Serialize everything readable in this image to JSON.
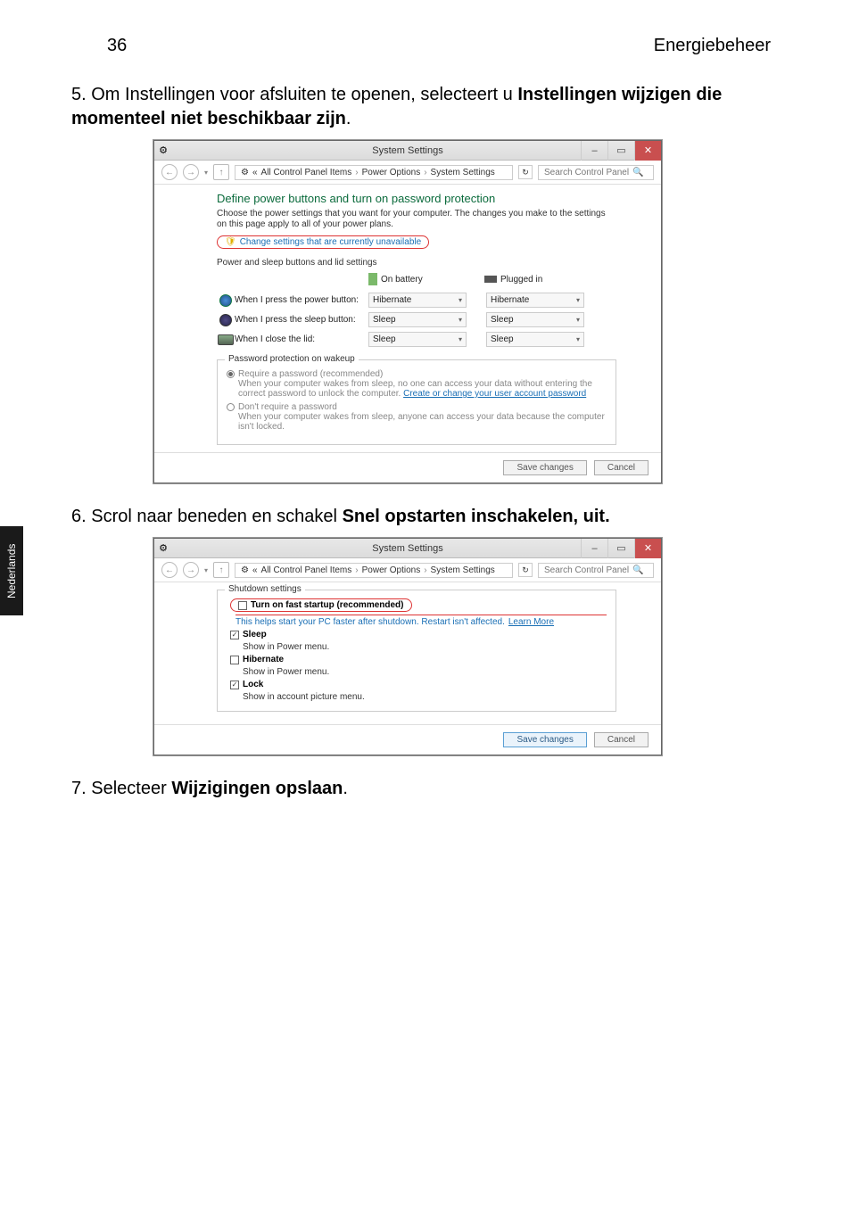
{
  "header": {
    "page_number": "36",
    "section": "Energiebeheer"
  },
  "sidebar": {
    "label": "Nederlands"
  },
  "steps": {
    "s5_num": "5.",
    "s5_text_a": "Om Instellingen voor afsluiten te openen, selecteert u ",
    "s5_bold": "Instellingen wijzigen die momenteel niet beschikbaar zijn",
    "s5_period": ".",
    "s6_num": "6.",
    "s6_text_a": "Scrol naar beneden en schakel  ",
    "s6_bold": "Snel opstarten inschakelen, uit.",
    "s7_num": "7.",
    "s7_text_a": "Selecteer ",
    "s7_bold": "Wijzigingen opslaan",
    "s7_period": "."
  },
  "win1": {
    "title": "System Settings",
    "breadcrumb": {
      "b1": "«",
      "b2": "All Control Panel Items",
      "b3": "Power Options",
      "b4": "System Settings"
    },
    "search_placeholder": "Search Control Panel",
    "heading": "Define power buttons and turn on password protection",
    "desc": "Choose the power settings that you want for your computer. The changes you make to the settings on this page apply to all of your power plans.",
    "change_link": "Change settings that are currently unavailable",
    "legend1": "Power and sleep buttons and lid settings",
    "col_battery": "On battery",
    "col_plugged": "Plugged in",
    "rows": {
      "power_lbl": "When I press the power button:",
      "sleep_lbl": "When I press the sleep button:",
      "lid_lbl": "When I close the lid:",
      "power_bat": "Hibernate",
      "power_plg": "Hibernate",
      "sleep_bat": "Sleep",
      "sleep_plg": "Sleep",
      "lid_bat": "Sleep",
      "lid_plg": "Sleep"
    },
    "legend2": "Password protection on wakeup",
    "opt1_title": "Require a password (recommended)",
    "opt1_desc": "When your computer wakes from sleep, no one can access your data without entering the correct password to unlock the computer. ",
    "opt1_link": "Create or change your user account password",
    "opt2_title": "Don't require a password",
    "opt2_desc": "When your computer wakes from sleep, anyone can access your data because the computer isn't locked.",
    "btn_save": "Save changes",
    "btn_cancel": "Cancel"
  },
  "win2": {
    "title": "System Settings",
    "breadcrumb": {
      "b1": "«",
      "b2": "All Control Panel Items",
      "b3": "Power Options",
      "b4": "System Settings"
    },
    "search_placeholder": "Search Control Panel",
    "legend": "Shutdown settings",
    "startup_label": "Turn on fast startup (recommended)",
    "startup_desc_a": "This helps start your PC faster after shutdown. Restart isn't affected. ",
    "startup_desc_link": "Learn More",
    "sleep_label": "Sleep",
    "sleep_desc": "Show in Power menu.",
    "hibernate_label": "Hibernate",
    "hibernate_desc": "Show in Power menu.",
    "lock_label": "Lock",
    "lock_desc": "Show in account picture menu.",
    "btn_save": "Save changes",
    "btn_cancel": "Cancel"
  }
}
